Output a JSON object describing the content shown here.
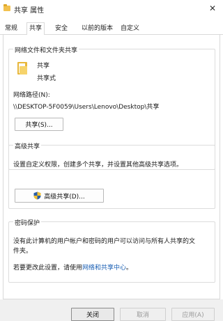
{
  "window": {
    "title": "共享 属性",
    "close_glyph": "✕"
  },
  "tabs": [
    {
      "label": "常规"
    },
    {
      "label": "共享"
    },
    {
      "label": "安全"
    },
    {
      "label": "以前的版本"
    },
    {
      "label": "自定义"
    }
  ],
  "network_sharing": {
    "heading": "网络文件和文件夹共享",
    "folder_name": "共享",
    "folder_status": "共享式",
    "network_path_label": "网络路径(N):",
    "network_path": "\\\\DESKTOP-5F0059\\Users\\Lenovo\\Desktop\\共享",
    "share_button": "共享(S)..."
  },
  "advanced_sharing": {
    "heading": "高级共享",
    "description": "设置自定义权限，创建多个共享，并设置其他高级共享选项。",
    "button": "高级共享(D)..."
  },
  "password_protection": {
    "heading": "密码保护",
    "description_line1": "没有此计算机的用户帐户和密码的用户可以访问与所有人共享的文",
    "description_line2": "件夹。",
    "change_prefix": "若要更改此设置，请使用",
    "change_link": "网络和共享中心",
    "change_suffix": "。"
  },
  "footer": {
    "close_button": "关闭",
    "cancel_button": "取消",
    "apply_button": "应用(A)"
  }
}
